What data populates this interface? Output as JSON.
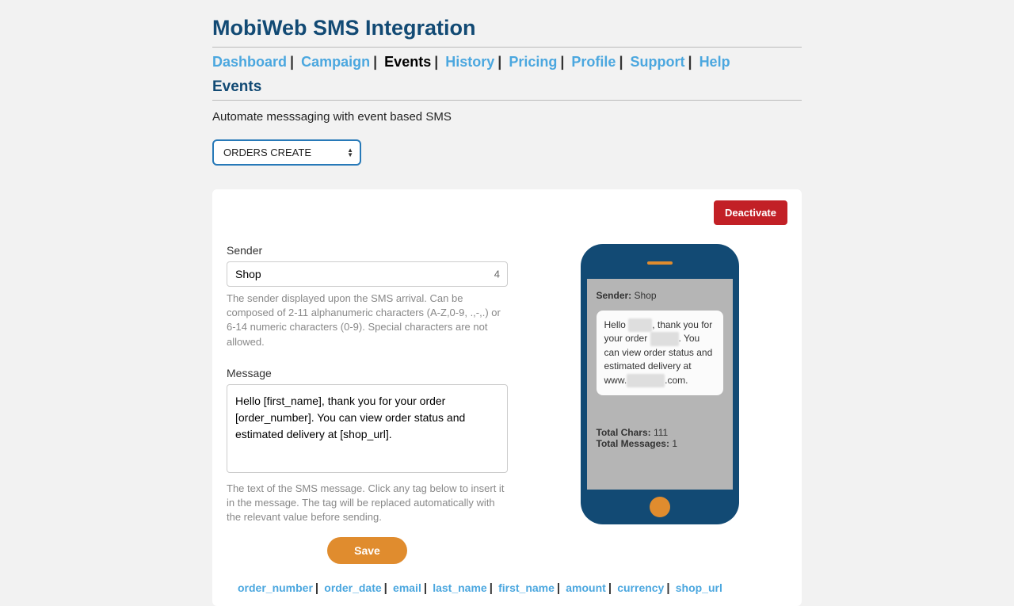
{
  "header": {
    "title": "MobiWeb SMS Integration"
  },
  "nav": {
    "items": [
      "Dashboard",
      "Campaign",
      "Events",
      "History",
      "Pricing",
      "Profile",
      "Support",
      "Help"
    ],
    "active_index": 2
  },
  "section": {
    "title": "Events",
    "subtitle": "Automate messsaging with event based SMS"
  },
  "event_select": {
    "value": "ORDERS CREATE"
  },
  "card": {
    "deactivate_label": "Deactivate",
    "sender": {
      "label": "Sender",
      "value": "Shop",
      "count": "4",
      "help": "The sender displayed upon the SMS arrival. Can be composed of 2-11 alphanumeric characters (A-Z,0-9, .,-,.) or 6-14 numeric characters (0-9). Special characters are not allowed."
    },
    "message": {
      "label": "Message",
      "value": "Hello [first_name], thank you for your order [order_number]. You can view order status and estimated delivery at [shop_url].",
      "help": "The text of the SMS message. Click any tag below to insert it in the message. The tag will be replaced automatically with the relevant value before sending."
    },
    "save_label": "Save"
  },
  "preview": {
    "sender_label": "Sender:",
    "sender_value": "Shop",
    "total_chars_label": "Total Chars:",
    "total_chars_value": "111",
    "total_messages_label": "Total Messages:",
    "total_messages_value": "1"
  },
  "tags": [
    "order_number",
    "order_date",
    "email",
    "last_name",
    "first_name",
    "amount",
    "currency",
    "shop_url"
  ]
}
